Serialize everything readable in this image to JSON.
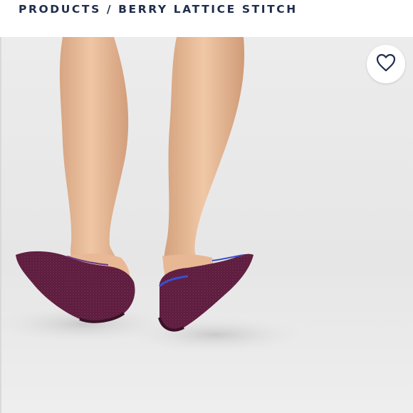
{
  "header": {
    "breadcrumb": "PRODUCTS / BERRY LATTICE STITCH"
  },
  "product": {
    "favorite_icon": "heart-outline-icon"
  },
  "colors": {
    "breadcrumb_text": "#1f2d4d",
    "shoe_berry": "#5c1f3f",
    "shoe_lining": "#3a4fd0",
    "background": "#e9e9e9"
  }
}
